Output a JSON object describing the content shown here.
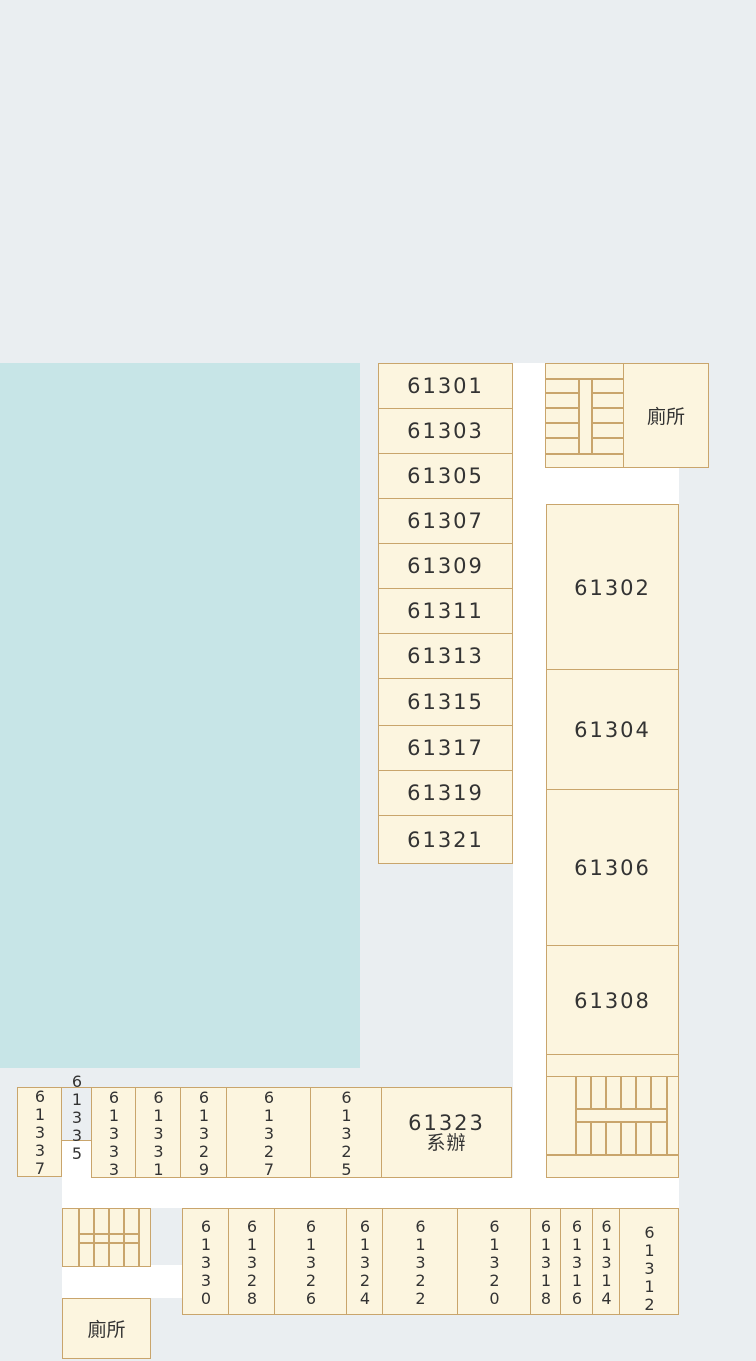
{
  "colors": {
    "background": "#eaeef1",
    "courtyard": "#c7e5e7",
    "corridor": "#ffffff",
    "room_fill": "#fcf5df",
    "room_border": "#c9a56c",
    "text": "#333333"
  },
  "west_rooms": [
    "61301",
    "61303",
    "61305",
    "61307",
    "61309",
    "61311",
    "61313",
    "61315",
    "61317",
    "61319",
    "61321"
  ],
  "east_rooms": [
    "61302",
    "61304",
    "61306",
    "61308"
  ],
  "restroom_label": "廁所",
  "north_south_rooms": {
    "r61337": "61337",
    "r61335": "61335",
    "r61333": "61333",
    "r61331": "61331",
    "r61329": "61329",
    "r61327": "61327",
    "r61325": "61325",
    "r61323": "61323",
    "office_label": "系辦"
  },
  "south_rooms": {
    "r61330": "61330",
    "r61328": "61328",
    "r61326": "61326",
    "r61324": "61324",
    "r61322": "61322",
    "r61320": "61320",
    "r61318": "61318",
    "r61316": "61316",
    "r61314": "61314",
    "r61312": "61312"
  }
}
